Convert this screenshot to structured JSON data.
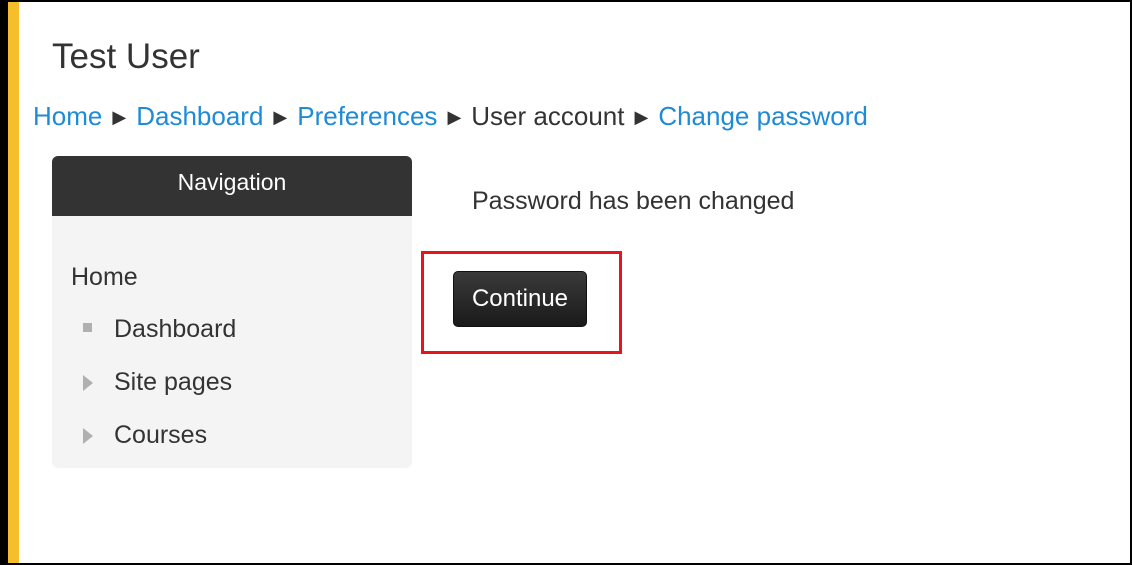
{
  "page": {
    "title": "Test User"
  },
  "breadcrumb": {
    "separator": "▶",
    "items": [
      {
        "label": "Home"
      },
      {
        "label": "Dashboard"
      },
      {
        "label": "Preferences"
      },
      {
        "label": "User account"
      },
      {
        "label": "Change password"
      }
    ]
  },
  "navigation": {
    "header": "Navigation",
    "home": "Home",
    "items": [
      {
        "label": "Dashboard",
        "icon": "bullet-square-icon"
      },
      {
        "label": "Site pages",
        "icon": "triangle-right-icon"
      },
      {
        "label": "Courses",
        "icon": "triangle-right-icon"
      }
    ]
  },
  "main": {
    "message": "Password has been changed",
    "continue_label": "Continue"
  },
  "colors": {
    "accent": "#f7be2b",
    "link": "#1f8ad6",
    "button_bg": "#222222",
    "highlight": "#e8141c"
  }
}
